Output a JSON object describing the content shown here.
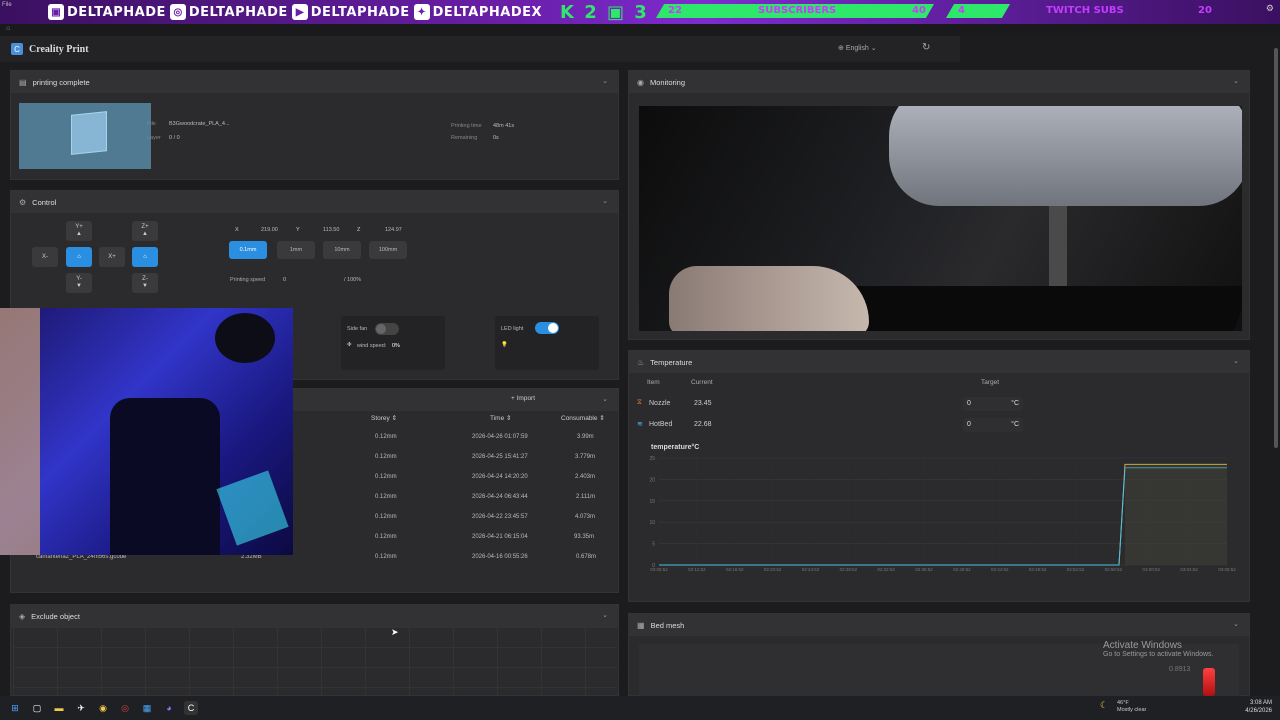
{
  "stream_overlay": {
    "file_menu": "File",
    "socials": [
      {
        "icon": "twitch-icon",
        "glyph": "▣",
        "handle": "DELTAPHADE"
      },
      {
        "icon": "instagram-icon",
        "glyph": "◎",
        "handle": "DELTAPHADE"
      },
      {
        "icon": "youtube-icon",
        "glyph": "▶",
        "handle": "DELTAPHADE"
      },
      {
        "icon": "twitter-icon",
        "glyph": "✦",
        "handle": "DELTAPHADEX"
      }
    ],
    "logos": "K 2 ▣ 3",
    "subscribers": {
      "current": "22",
      "label": "SUBSCRIBERS",
      "goal": "40"
    },
    "twitch_subs": {
      "current": "4",
      "label": "TWITCH SUBS",
      "goal": "20"
    },
    "accent": "#2ee86a"
  },
  "app": {
    "title": "Creality Print",
    "language": "English"
  },
  "status_panel": {
    "title": "printing complete",
    "file_label": "File",
    "file_value": "B3Gwoodcrate_PLA_4...",
    "layer_label": "Layer",
    "layer_value": "0 / 0",
    "print_time_label": "Printing time",
    "print_time_value": "48m 41s",
    "remaining_label": "Remaining",
    "remaining_value": "0s"
  },
  "control_panel": {
    "title": "Control",
    "jog": {
      "y_plus": "Y+",
      "y_minus": "Y-",
      "x_minus": "X-",
      "x_plus": "X+",
      "z_plus": "Z+",
      "z_minus": "Z-"
    },
    "x_label": "X",
    "x_value": "219.00",
    "y_label": "Y",
    "y_value": "113.50",
    "z_label": "Z",
    "z_value": "124.97",
    "steps": [
      "0.1mm",
      "1mm",
      "10mm",
      "100mm"
    ],
    "speed_label": "Printing speed",
    "speed_value": "0",
    "speed_percent": "/ 100%",
    "side_fan_label": "Side fan",
    "wind_speed_label": "wind speed:",
    "wind_speed_value": "0%",
    "led_label": "LED light"
  },
  "files_panel": {
    "import_label": "Import",
    "columns": {
      "storey": "Storey",
      "time": "Time",
      "consumable": "Consumable"
    },
    "rows": [
      {
        "storey": "0.12mm",
        "time": "2026-04-26 01:07:59",
        "consumable": "3.99m"
      },
      {
        "storey": "0.12mm",
        "time": "2026-04-25 15:41:27",
        "consumable": "3.779m"
      },
      {
        "storey": "0.12mm",
        "time": "2026-04-24 14:20:20",
        "consumable": "2.403m"
      },
      {
        "storey": "0.12mm",
        "time": "2026-04-24 06:43:44",
        "consumable": "2.111m"
      },
      {
        "storey": "0.12mm",
        "time": "2026-04-22 23:45:57",
        "consumable": "4.073m"
      },
      {
        "storey": "0.12mm",
        "time": "2026-04-21 06:15:04",
        "consumable": "93.35m"
      },
      {
        "name": "camantena2_PLA_24m56s.gcode",
        "size": "2.32MB",
        "storey": "0.12mm",
        "time": "2026-04-16 00:55:26",
        "consumable": "0.678m"
      }
    ]
  },
  "exclude_panel": {
    "title": "Exclude object"
  },
  "monitoring_panel": {
    "title": "Monitoring"
  },
  "temperature_panel": {
    "title": "Temperature",
    "col_item": "Item",
    "col_current": "Current",
    "col_target": "Target",
    "nozzle_label": "Nozzle",
    "nozzle_current": "23.45",
    "nozzle_target": "0",
    "hotbed_label": "HotBed",
    "hotbed_current": "22.68",
    "hotbed_target": "0",
    "unit": "°C"
  },
  "chart_data": {
    "type": "line",
    "title": "temperature°C",
    "ylim": [
      0,
      25
    ],
    "yticks": [
      "25",
      "20",
      "15",
      "10",
      "5",
      "0"
    ],
    "x": [
      "02:08:52",
      "02:12:52",
      "02:16:52",
      "02:20:52",
      "02:24:52",
      "02:28:52",
      "02:32:52",
      "02:36:52",
      "02:40:52",
      "02:44:52",
      "02:48:52",
      "02:52:52",
      "02:56:52",
      "03:00:52",
      "03:04:52",
      "03:08:52"
    ],
    "series": [
      {
        "color": "#e8b93a",
        "values": [
          0,
          0,
          0,
          0,
          0,
          0,
          0,
          0,
          0,
          0,
          0,
          0,
          0,
          0,
          0,
          23.5,
          23.5,
          23.5
        ]
      },
      {
        "color": "#4ac0e8",
        "values": [
          0,
          0,
          0,
          0,
          0,
          0,
          0,
          0,
          0,
          0,
          0,
          0,
          0,
          0,
          0,
          22.7,
          22.7,
          22.7
        ]
      }
    ]
  },
  "bed_mesh_panel": {
    "title": "Bed mesh",
    "value": "0.8913"
  },
  "activate_windows": {
    "line1": "Activate Windows",
    "line2": "Go to Settings to activate Windows."
  },
  "taskbar": {
    "weather_temp": "46°F",
    "weather_desc": "Mostly clear",
    "time": "3:08 AM",
    "date": "4/26/2026"
  }
}
